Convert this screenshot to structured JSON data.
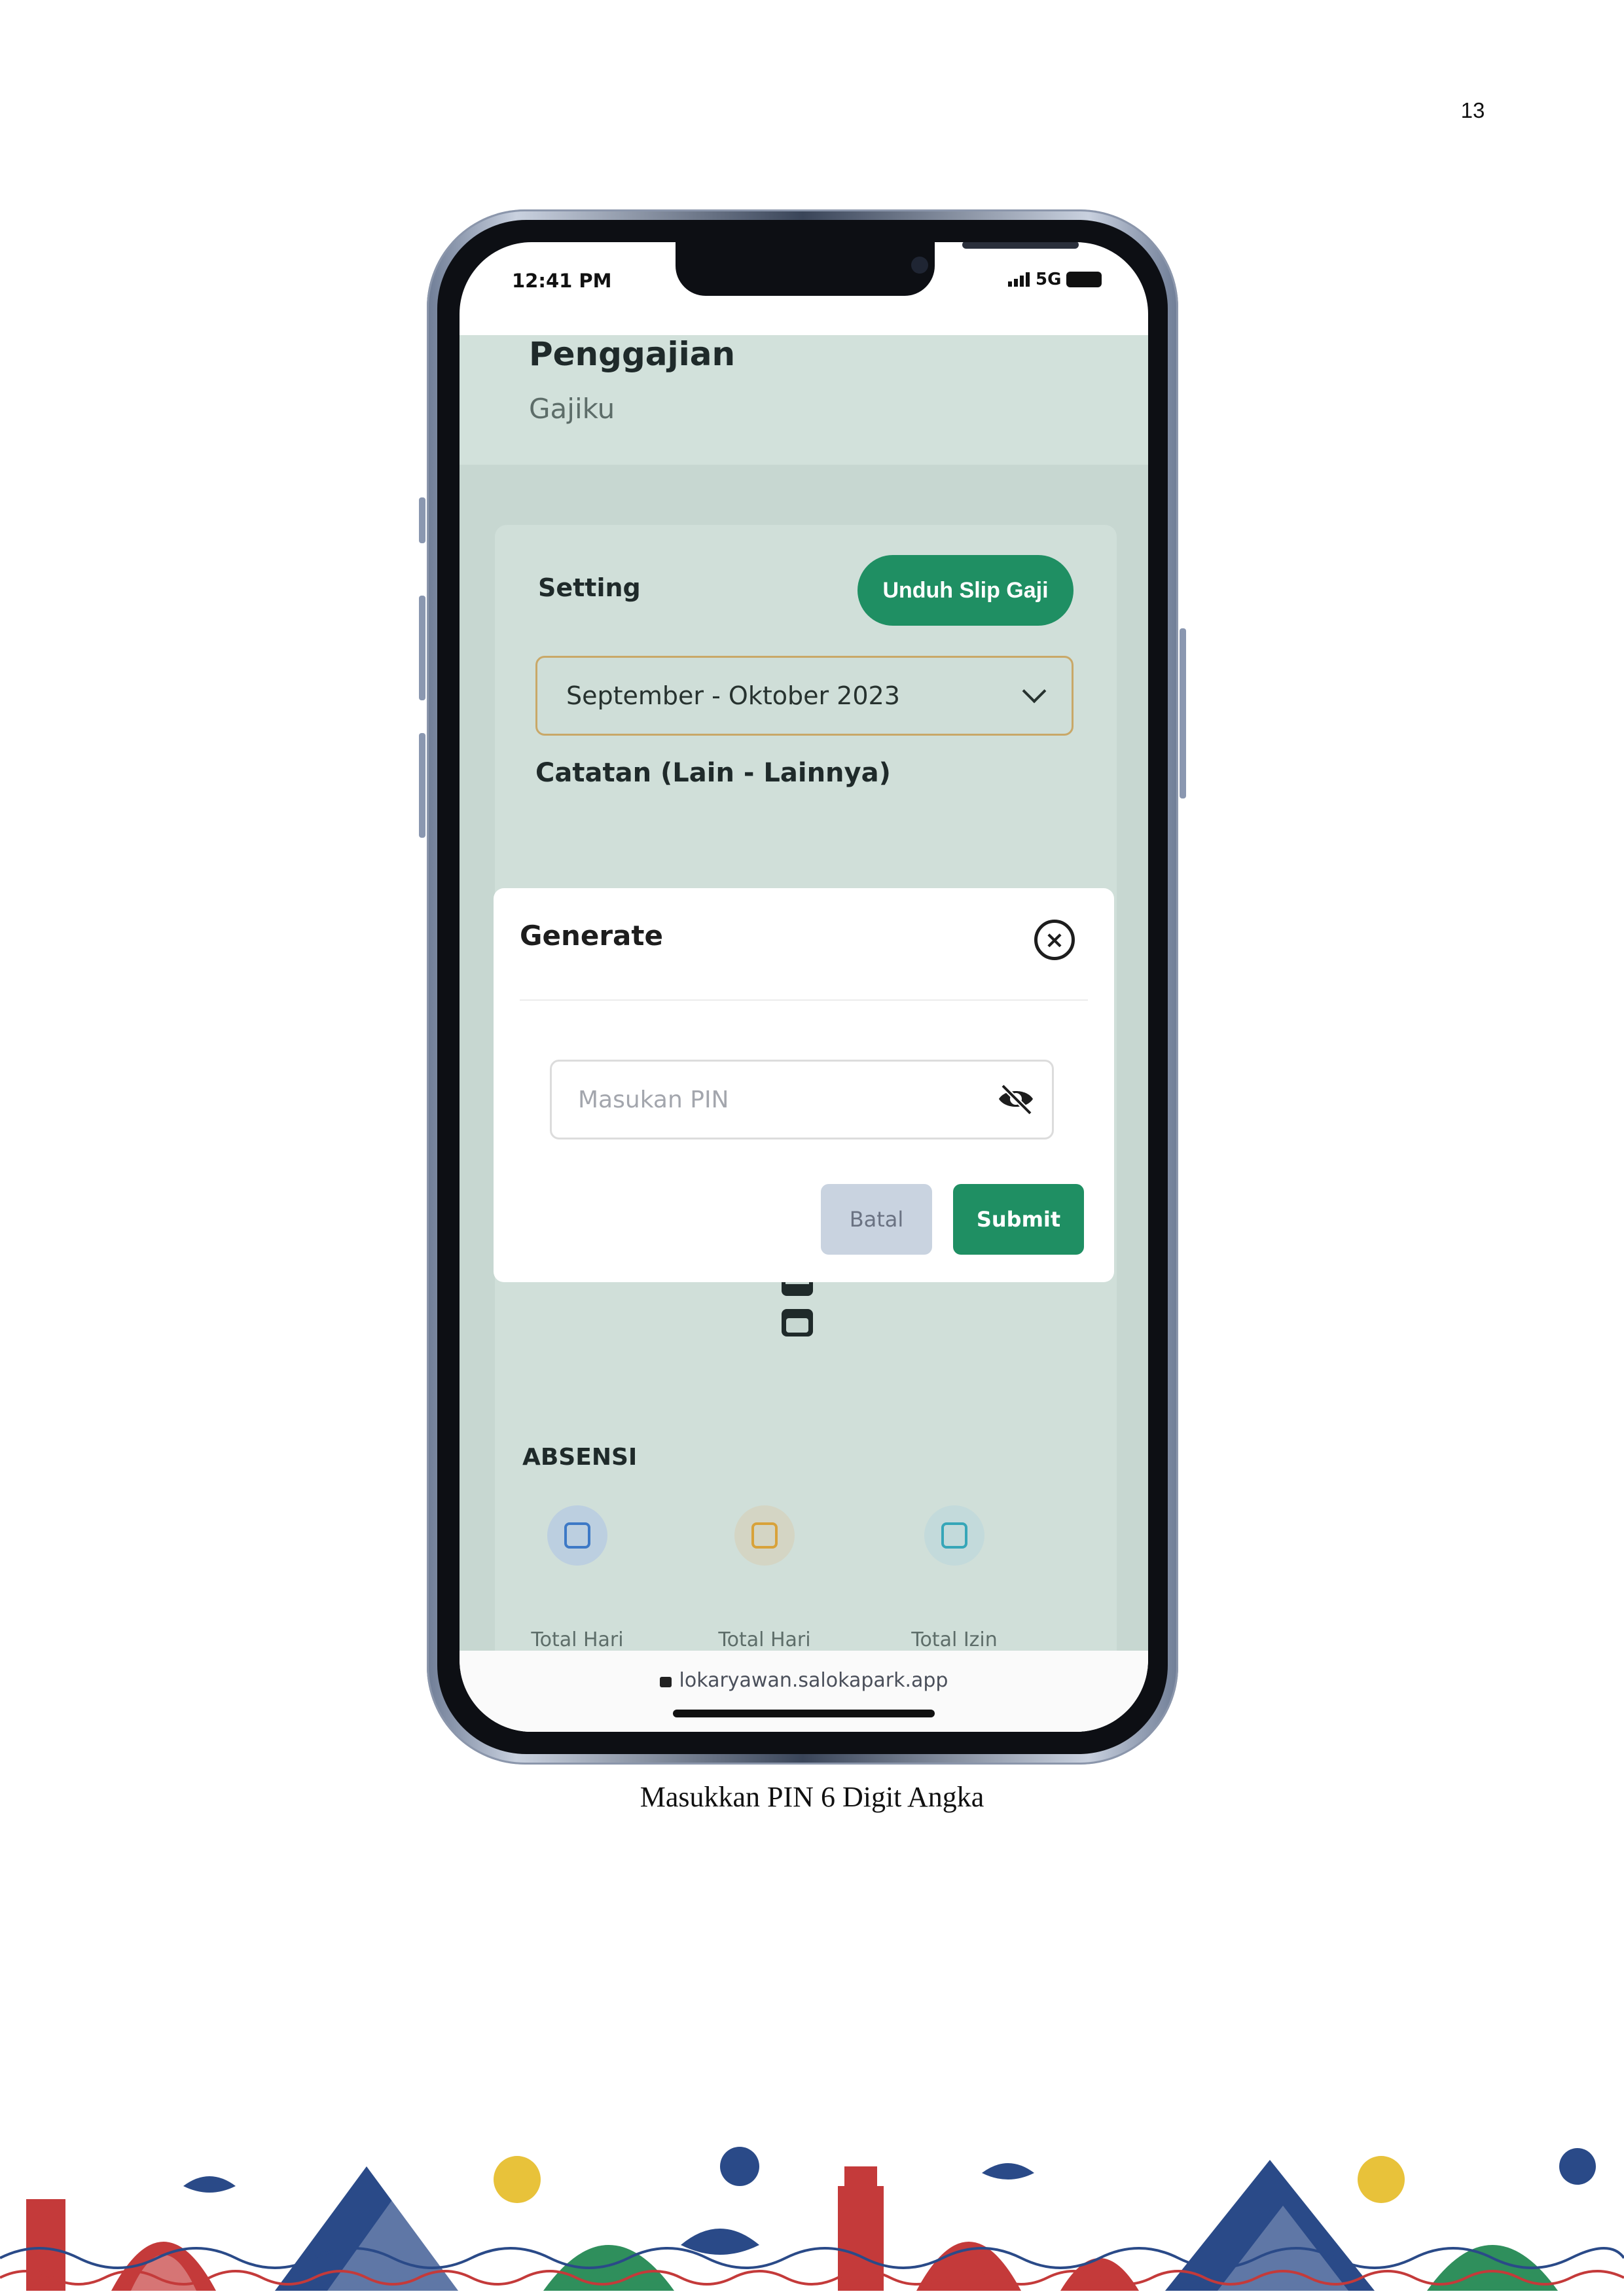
{
  "page": {
    "number": "13",
    "caption": "Masukkan PIN 6 Digit Angka"
  },
  "status_bar": {
    "time": "12:41 PM",
    "network": "5G"
  },
  "header": {
    "title": "Penggajian",
    "subtitle": "Gajiku"
  },
  "settings_card": {
    "label": "Setting",
    "download_button": "Unduh Slip Gaji",
    "period_value": "September - Oktober 2023",
    "notes_label": "Catatan (Lain - Lainnya)"
  },
  "modal": {
    "title": "Generate",
    "close_icon": "close-circle-icon",
    "pin_placeholder": "Masukan PIN",
    "visibility_icon": "eye-off-icon",
    "cancel_button": "Batal",
    "submit_button": "Submit"
  },
  "absensi": {
    "heading": "ABSENSI",
    "items": [
      {
        "label": "Total Hari",
        "icon": "calendar-icon",
        "color": "#3d79c6"
      },
      {
        "label": "Total Hari",
        "icon": "calendar-heart-icon",
        "color": "#d8a23a"
      },
      {
        "label": "Total Izin",
        "icon": "calendar-check-icon",
        "color": "#36a6b8"
      }
    ]
  },
  "browser": {
    "url": "lokaryawan.salokapark.app"
  },
  "colors": {
    "primary": "#1f8f63",
    "background": "#c7d7d1",
    "period_border": "#c9a868",
    "cancel_bg": "#c9d3e0"
  }
}
